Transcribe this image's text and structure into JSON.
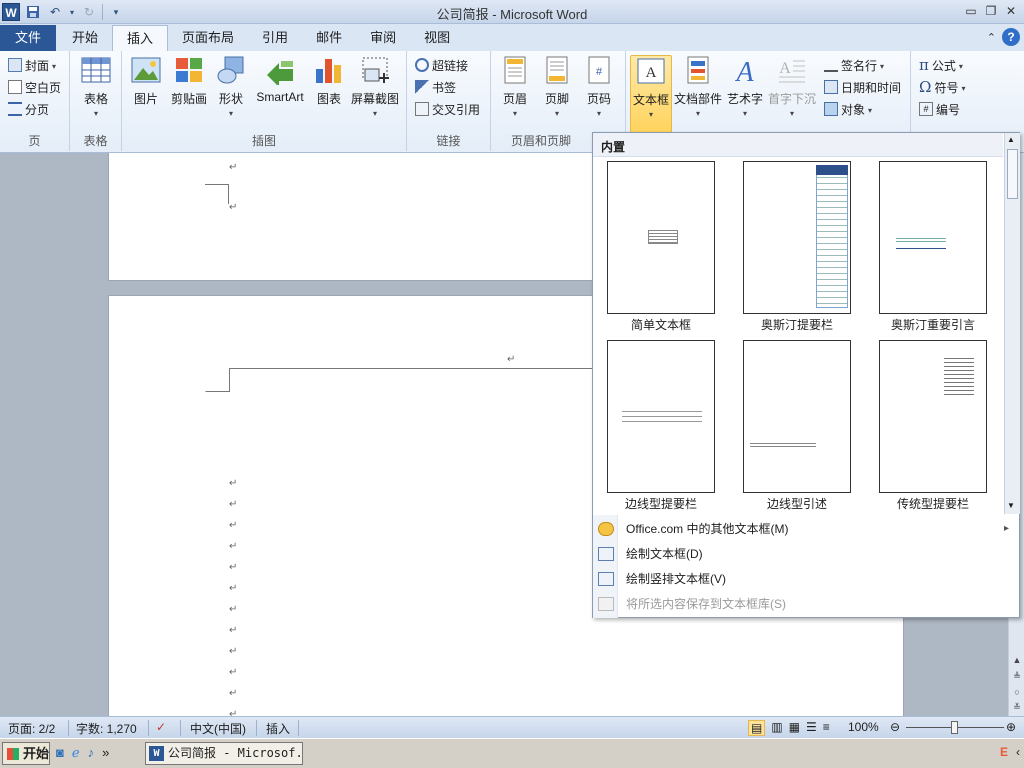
{
  "window": {
    "title": "公司简报 - Microsoft Word"
  },
  "tabs": [
    "文件",
    "开始",
    "插入",
    "页面布局",
    "引用",
    "邮件",
    "审阅",
    "视图"
  ],
  "ribbon": {
    "page_group": {
      "label": "页",
      "items": [
        "封面",
        "空白页",
        "分页"
      ]
    },
    "table_group": {
      "label": "表格",
      "items": [
        "表格"
      ]
    },
    "illustrations_group": {
      "label": "插图",
      "items": [
        "图片",
        "剪贴画",
        "形状",
        "SmartArt",
        "图表",
        "屏幕截图"
      ]
    },
    "links_group": {
      "label": "链接",
      "items": [
        "超链接",
        "书签",
        "交叉引用"
      ]
    },
    "header_footer_group": {
      "label": "页眉和页脚",
      "items": [
        "页眉",
        "页脚",
        "页码"
      ]
    },
    "text_group": {
      "items": [
        "文本框",
        "文档部件",
        "艺术字",
        "首字下沉"
      ],
      "small_items": [
        "签名行",
        "日期和时间",
        "对象"
      ]
    },
    "symbols_group": {
      "items": [
        "公式",
        "符号",
        "编号"
      ]
    }
  },
  "gallery": {
    "header": "内置",
    "thumbs": [
      "简单文本框",
      "奥斯汀提要栏",
      "奥斯汀重要引言",
      "边线型提要栏",
      "边线型引述",
      "传统型提要栏"
    ],
    "menu": [
      {
        "label": "Office.com 中的其他文本框(M)",
        "disabled": false,
        "arrow": "▸"
      },
      {
        "label": "绘制文本框(D)",
        "disabled": false
      },
      {
        "label": "绘制竖排文本框(V)",
        "disabled": false
      },
      {
        "label": "将所选内容保存到文本框库(S)",
        "disabled": true
      }
    ]
  },
  "statusbar": {
    "page": "页面: 2/2",
    "words": "字数: 1,270",
    "language": "中文(中国)",
    "mode": "插入",
    "zoom": "100%"
  },
  "taskbar": {
    "start": "开始",
    "task": "公司简报 - Microsof..."
  },
  "marks": {
    "paragraph": "↵"
  }
}
